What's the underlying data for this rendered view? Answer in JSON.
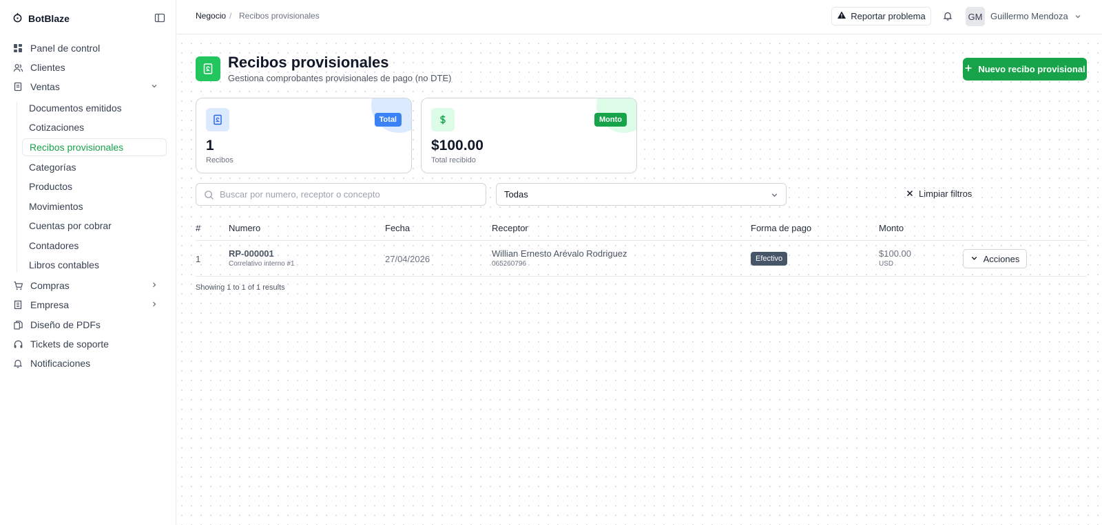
{
  "brand": {
    "name": "BotBlaze"
  },
  "sidebar": {
    "items": [
      {
        "label": "Panel de control",
        "icon": "dashboard-icon"
      },
      {
        "label": "Clientes",
        "icon": "users-icon"
      },
      {
        "label": "Ventas",
        "icon": "receipt-icon",
        "expanded": true
      },
      {
        "label": "Compras",
        "icon": "cart-icon"
      },
      {
        "label": "Empresa",
        "icon": "building-icon"
      },
      {
        "label": "Diseño de PDFs",
        "icon": "files-icon"
      },
      {
        "label": "Tickets de soporte",
        "icon": "headset-icon"
      },
      {
        "label": "Notificaciones",
        "icon": "bell-icon"
      }
    ],
    "ventas_sub": [
      "Documentos emitidos",
      "Cotizaciones",
      "Recibos provisionales",
      "Categorías",
      "Productos",
      "Movimientos",
      "Cuentas por cobrar",
      "Contadores",
      "Libros contables"
    ],
    "active_sub": "Recibos provisionales"
  },
  "header": {
    "breadcrumb": [
      "Negocio",
      "Recibos provisionales"
    ],
    "breadcrumb_sep": "/",
    "report_label": "Reportar problema",
    "user_initials": "GM",
    "user_name": "Guillermo Mendoza"
  },
  "page": {
    "title": "Recibos provisionales",
    "subtitle": "Gestiona comprobantes provisionales de pago (no DTE)",
    "new_button": "Nuevo recibo provisional"
  },
  "stats": [
    {
      "badge": "Total",
      "value": "1",
      "label": "Recibos",
      "color": "#3b82f6"
    },
    {
      "badge": "Monto",
      "value": "$100.00",
      "label": "Total recibido",
      "color": "#16a34a"
    }
  ],
  "filters": {
    "search_placeholder": "Buscar por numero, receptor o concepto",
    "select_value": "Todas",
    "clear_label": "Limpiar filtros"
  },
  "table": {
    "headers": [
      "#",
      "Numero",
      "Fecha",
      "Receptor",
      "Forma de pago",
      "Monto"
    ],
    "rows": [
      {
        "index": "1",
        "numero": "RP-000001",
        "numero_sub": "Correlativo interno #1",
        "fecha": "27/04/2026",
        "receptor": "Willian Ernesto Arévalo Rodriguez",
        "receptor_sub": "065260796",
        "forma_pago": "Efectivo",
        "monto": "$100.00",
        "moneda": "USD",
        "actions_label": "Acciones"
      }
    ],
    "summary": "Showing 1 to 1 of 1 results"
  },
  "colors": {
    "accent_green": "#16a34a",
    "accent_blue": "#3b82f6",
    "pill_slate": "#475569"
  }
}
